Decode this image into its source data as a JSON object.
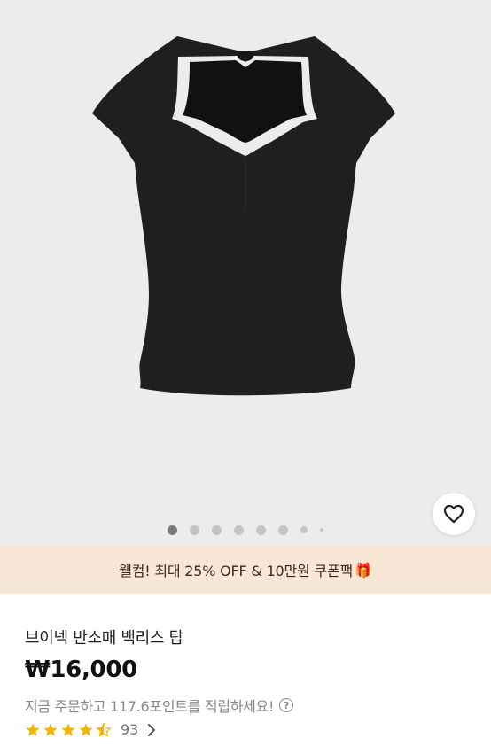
{
  "product": {
    "title": "브이넥 반소매 백리스 탑",
    "price": "₩16,000",
    "points_text": "지금 주문하고 117.6포인트를 적립하세요!",
    "help_label": "?",
    "rating": 4.5,
    "review_count": "93"
  },
  "promo": {
    "text": "웰컴! 최대 25% OFF & 10만원 쿠폰팩",
    "gift_emoji": "🎁"
  },
  "gallery": {
    "image_count": 8,
    "active_index": 0,
    "wishlist_icon": "heart-outline-icon"
  },
  "colors": {
    "gallery_bg": "#ececec",
    "promo_bg": "#f8e7d6",
    "star": "#f5b400",
    "garment": "#1f1f1f"
  }
}
